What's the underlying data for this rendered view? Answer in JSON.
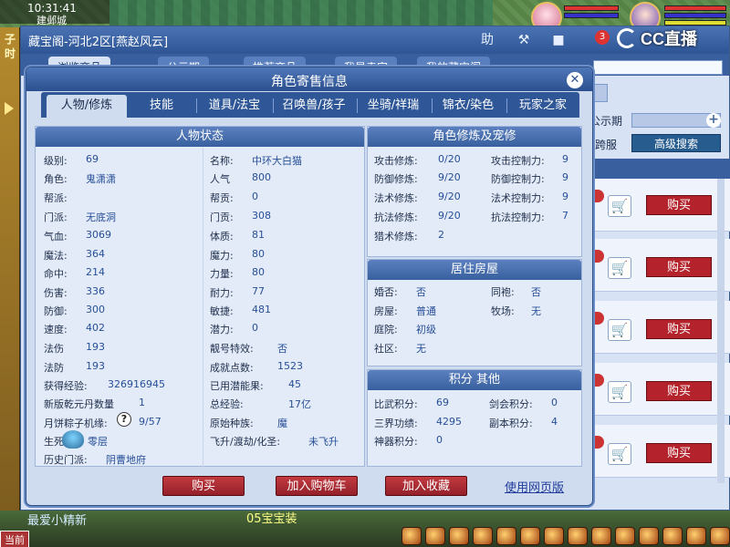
{
  "hud": {
    "time": "10:31:41",
    "location": "建邺城"
  },
  "left_strip": {
    "label_1": "子",
    "label_2": "时"
  },
  "overlay": {
    "cc_logo_text": "CC直播",
    "notif_count": "3"
  },
  "shop": {
    "title": "藏宝阁-河北2区[燕赵风云]",
    "tabs": [
      "浏览商品",
      "公示期",
      "推荐商品",
      "我是卖家",
      "我的藏宝阁"
    ],
    "side_labels": {
      "publicity": "公示期",
      "cross_server": "跨服"
    },
    "advanced_search": "高级搜索",
    "buy_label": "购买",
    "icon_buttons": {
      "help": "助",
      "hammer": "⚒",
      "stop": "■"
    }
  },
  "dialog": {
    "title": "角色寄售信息",
    "tabs": [
      "人物/修炼",
      "技能",
      "道具/法宝",
      "召唤兽/孩子",
      "坐骑/祥瑞",
      "锦衣/染色",
      "玩家之家"
    ],
    "active_tab": 0,
    "status_panel": {
      "heading": "人物状态",
      "left_col": [
        {
          "label": "级别:",
          "value": "69"
        },
        {
          "label": "角色:",
          "value": "鬼潇潇"
        },
        {
          "label": "帮派:",
          "value": ""
        },
        {
          "label": "门派:",
          "value": "无底洞"
        },
        {
          "label": "气血:",
          "value": "3069"
        },
        {
          "label": "魔法:",
          "value": "364"
        },
        {
          "label": "命中:",
          "value": "214"
        },
        {
          "label": "伤害:",
          "value": "336"
        },
        {
          "label": "防御:",
          "value": "300"
        },
        {
          "label": "速度:",
          "value": "402"
        },
        {
          "label": "法伤",
          "value": "193"
        },
        {
          "label": "法防",
          "value": "193"
        },
        {
          "label": "获得经验:",
          "value": "326916945"
        },
        {
          "label": "新版乾元丹数量",
          "value": "1"
        },
        {
          "label": "月饼粽子机缘:",
          "value": "9/57"
        },
        {
          "label": "生死",
          "value": "零层"
        },
        {
          "label": "历史门派:",
          "value": "阴曹地府"
        }
      ],
      "right_col": [
        {
          "label": "名称:",
          "value": "中环大白猫"
        },
        {
          "label": "人气",
          "value": "800"
        },
        {
          "label": "帮贡:",
          "value": "0"
        },
        {
          "label": "门贡:",
          "value": "308"
        },
        {
          "label": "体质:",
          "value": "81"
        },
        {
          "label": "魔力:",
          "value": "80"
        },
        {
          "label": "力量:",
          "value": "80"
        },
        {
          "label": "耐力:",
          "value": "77"
        },
        {
          "label": "敏捷:",
          "value": "481"
        },
        {
          "label": "潜力:",
          "value": "0"
        },
        {
          "label": "靓号特效:",
          "value": "否"
        },
        {
          "label": "成就点数:",
          "value": "1523"
        },
        {
          "label": "已用潜能果:",
          "value": "45"
        },
        {
          "label": "总经验:",
          "value": "17亿"
        },
        {
          "label": "原始种族:",
          "value": "魔"
        },
        {
          "label": "飞升/渡劫/化圣:",
          "value": "未飞升"
        }
      ]
    },
    "cultivation_panel": {
      "heading": "角色修炼及宠修",
      "rows": [
        {
          "l1": "攻击修炼:",
          "v1": "0/20",
          "l2": "攻击控制力:",
          "v2": "9"
        },
        {
          "l1": "防御修炼:",
          "v1": "9/20",
          "l2": "防御控制力:",
          "v2": "9"
        },
        {
          "l1": "法术修炼:",
          "v1": "9/20",
          "l2": "法术控制力:",
          "v2": "9"
        },
        {
          "l1": "抗法修炼:",
          "v1": "9/20",
          "l2": "抗法控制力:",
          "v2": "7"
        },
        {
          "l1": "猎术修炼:",
          "v1": "2",
          "l2": "",
          "v2": ""
        }
      ]
    },
    "house_panel": {
      "heading": "居住房屋",
      "rows": [
        {
          "l1": "婚否:",
          "v1": "否",
          "l2": "同袍:",
          "v2": "否"
        },
        {
          "l1": "房屋:",
          "v1": "普通",
          "l2": "牧场:",
          "v2": "无"
        },
        {
          "l1": "庭院:",
          "v1": "初级",
          "l2": "",
          "v2": ""
        },
        {
          "l1": "社区:",
          "v1": "无",
          "l2": "",
          "v2": ""
        }
      ]
    },
    "score_panel": {
      "heading": "积分 其他",
      "rows": [
        {
          "l1": "比武积分:",
          "v1": "69",
          "l2": "剑会积分:",
          "v2": "0"
        },
        {
          "l1": "三界功绩:",
          "v1": "4295",
          "l2": "副本积分:",
          "v2": "4"
        },
        {
          "l1": "神器积分:",
          "v1": "0",
          "l2": "",
          "v2": ""
        }
      ]
    },
    "buttons": {
      "buy": "购买",
      "add_cart": "加入购物车",
      "add_fav": "加入收藏",
      "web_version": "使用网页版"
    }
  },
  "bottom": {
    "chat_left": "最爱小精新",
    "chat_mid": "05宝宝装",
    "current_btn": "当前"
  }
}
